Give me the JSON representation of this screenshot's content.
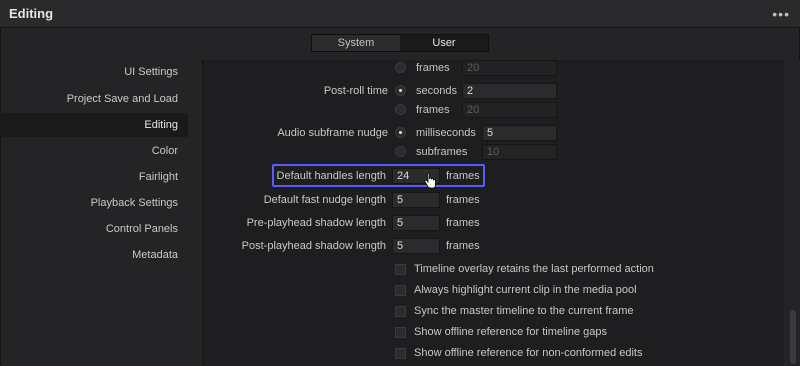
{
  "window": {
    "title": "Editing",
    "more_icon": "•••"
  },
  "tabs": [
    {
      "label": "System"
    },
    {
      "label": "User"
    }
  ],
  "sidebar": {
    "items": [
      {
        "label": "UI Settings"
      },
      {
        "label": "Project Save and Load"
      },
      {
        "label": "Editing"
      },
      {
        "label": "Color"
      },
      {
        "label": "Fairlight"
      },
      {
        "label": "Playback Settings"
      },
      {
        "label": "Control Panels"
      },
      {
        "label": "Metadata"
      }
    ]
  },
  "content": {
    "top_frames_option": {
      "label": "frames",
      "value": "20"
    },
    "post_roll": {
      "label": "Post-roll time",
      "opt1": "seconds",
      "opt1_value": "2",
      "opt2": "frames",
      "opt2_value": "20"
    },
    "audio_nudge": {
      "label": "Audio subframe nudge",
      "opt1": "milliseconds",
      "opt1_value": "5",
      "opt2": "subframes",
      "opt2_value": "10"
    },
    "default_handles": {
      "label": "Default handles length",
      "value": "24",
      "unit": "frames"
    },
    "fast_nudge": {
      "label": "Default fast nudge length",
      "value": "5",
      "unit": "frames"
    },
    "pre_shadow": {
      "label": "Pre-playhead shadow length",
      "value": "5",
      "unit": "frames"
    },
    "post_shadow": {
      "label": "Post-playhead shadow length",
      "value": "5",
      "unit": "frames"
    },
    "checkboxes": [
      {
        "label": "Timeline overlay retains the last performed action"
      },
      {
        "label": "Always highlight current clip in the media pool"
      },
      {
        "label": "Sync the master timeline to the current frame"
      },
      {
        "label": "Show offline reference for timeline gaps"
      },
      {
        "label": "Show offline reference for non-conformed edits"
      }
    ]
  }
}
